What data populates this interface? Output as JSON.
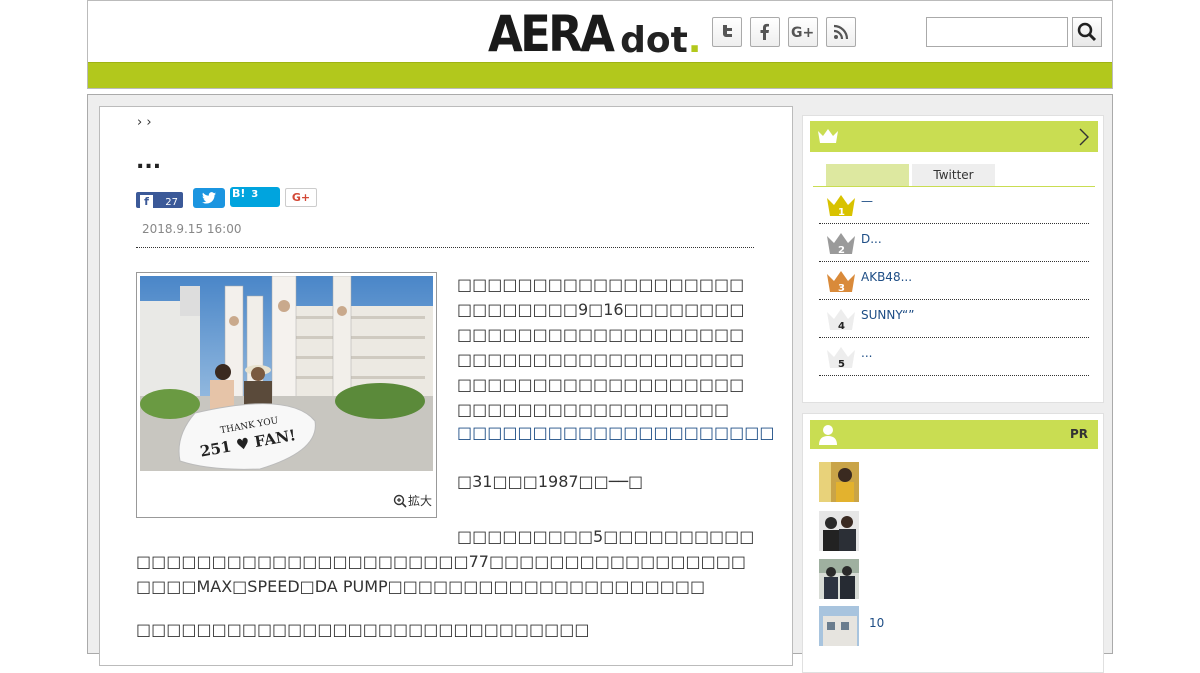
{
  "header": {
    "logo_main": "AERA",
    "logo_sub": "dot",
    "logo_dot": ".",
    "social_icons": [
      "twitter-icon",
      "facebook-icon",
      "google-plus-icon",
      "rss-icon"
    ],
    "search_placeholder": ""
  },
  "article": {
    "breadcrumb": "› ›",
    "title": "...",
    "facebook_count": "27",
    "hatena_label": "B!",
    "hatena_count": "3",
    "gplus_label": "G+",
    "date": "2018.9.15 16:00",
    "photo_banner_line1": "THANK YOU",
    "photo_banner_line2": "251 ♥ FAN!",
    "zoom_label": "拡大",
    "para_a": "□□□□□□□□□□□□□□□□□□□□□□□□□□□9□16□□□□□□□□□□□□□□□□□□□□□□□□□□□□□□□□□□□□□□□□□□□□□□□□□□□□□□□□□□□□□□□□□□□□□□□□□□□□□□□□□□□",
    "link_text": "□□□□□□□□□□□□□□□□□□□□□",
    "line_b": "□31□□□1987□□──□",
    "para_c": "□□□□□□□□□5□□□□□□□□□□□□□□□□□□□□□□□□□□□□□□□□77□□□□□□□□□□□□□□□□□□□□□MAX□SPEED□DA PUMP□□□□□□□□□□□□□□□□□□□□□",
    "para_d": "□□□□□□□□□□□□□□□□□□□□□□□□□□□□□□"
  },
  "ranking": {
    "tab_1": "",
    "tab_2": "Twitter",
    "items": [
      {
        "rank": "1",
        "text": "—",
        "color": "#d8c200"
      },
      {
        "rank": "2",
        "text": "D...",
        "color": "#9a9a9a"
      },
      {
        "rank": "3",
        "text": "AKB48...",
        "color": "#d98a3a"
      },
      {
        "rank": "4",
        "text": "SUNNY“”",
        "color": "#e8e8e8"
      },
      {
        "rank": "5",
        "text": "...",
        "color": "#e8e8e8"
      }
    ]
  },
  "pr": {
    "label": "PR",
    "items": [
      {
        "text": ""
      },
      {
        "text": ""
      },
      {
        "text": ""
      },
      {
        "text": "10"
      }
    ]
  },
  "colors": {
    "accent_green": "#b2c81c",
    "sidebar_green": "#c9dd52",
    "link_blue": "#1d4d85"
  }
}
